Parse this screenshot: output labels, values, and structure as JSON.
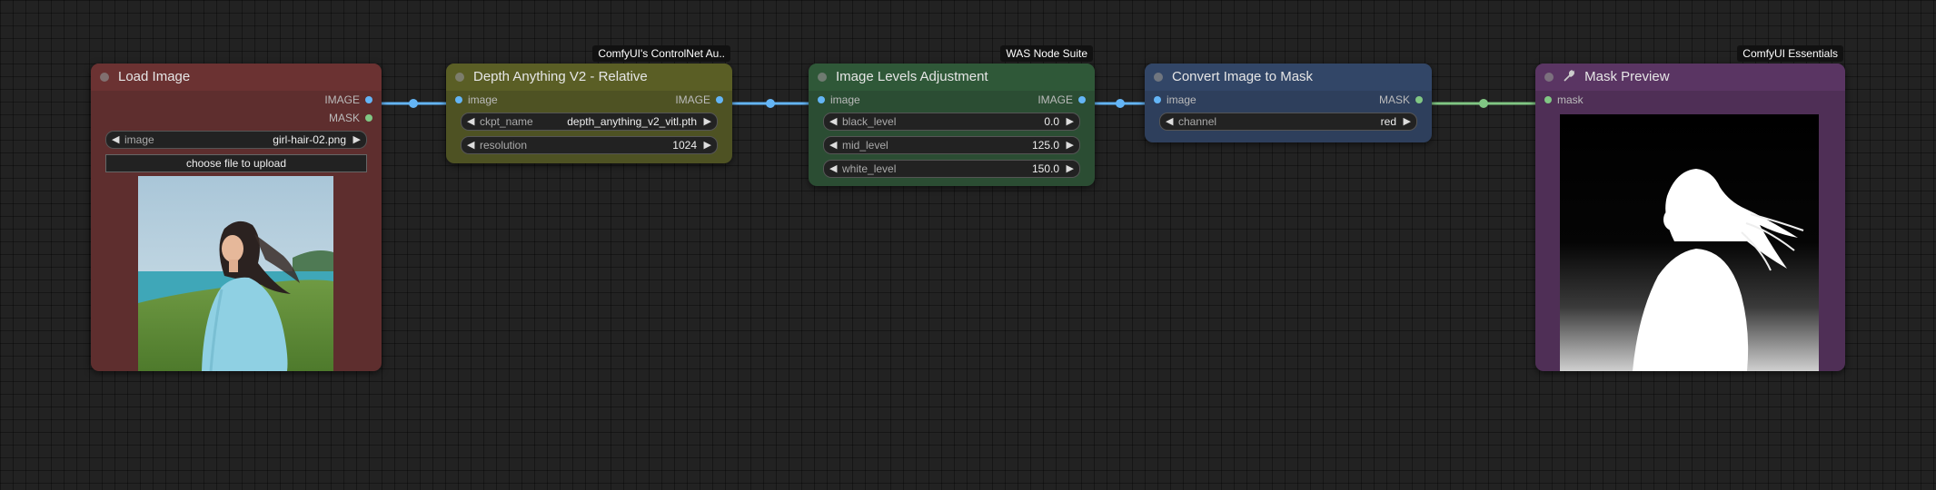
{
  "nodes": {
    "load_image": {
      "title": "Load Image",
      "outputs": [
        "IMAGE",
        "MASK"
      ],
      "widget": {
        "name": "image",
        "value": "girl-hair-02.png"
      },
      "upload_label": "choose file to upload"
    },
    "depth": {
      "title": "Depth Anything V2 - Relative",
      "badge": "ComfyUI's ControlNet Au..",
      "input": "image",
      "output": "IMAGE",
      "widgets": [
        {
          "name": "ckpt_name",
          "value": "depth_anything_v2_vitl.pth"
        },
        {
          "name": "resolution",
          "value": "1024"
        }
      ]
    },
    "levels": {
      "title": "Image Levels Adjustment",
      "badge": "WAS Node Suite",
      "input": "image",
      "output": "IMAGE",
      "widgets": [
        {
          "name": "black_level",
          "value": "0.0"
        },
        {
          "name": "mid_level",
          "value": "125.0"
        },
        {
          "name": "white_level",
          "value": "150.0"
        }
      ]
    },
    "convert": {
      "title": "Convert Image to Mask",
      "input": "image",
      "output": "MASK",
      "widgets": [
        {
          "name": "channel",
          "value": "red"
        }
      ]
    },
    "preview": {
      "title": "Mask Preview",
      "badge": "ComfyUI Essentials",
      "input": "mask"
    }
  },
  "colors": {
    "image_wire": "#64b5f6",
    "mask_wire": "#81c784",
    "load_image_body": "#5e2e2e",
    "depth_body": "#4e5223",
    "levels_body": "#2b4d33",
    "convert_body": "#2e3f5c",
    "preview_body": "#4f2f56"
  },
  "icons": {
    "preview_title_icon": "wrench-icon",
    "widget_left": "left-triangle-icon",
    "widget_right": "right-triangle-icon"
  }
}
